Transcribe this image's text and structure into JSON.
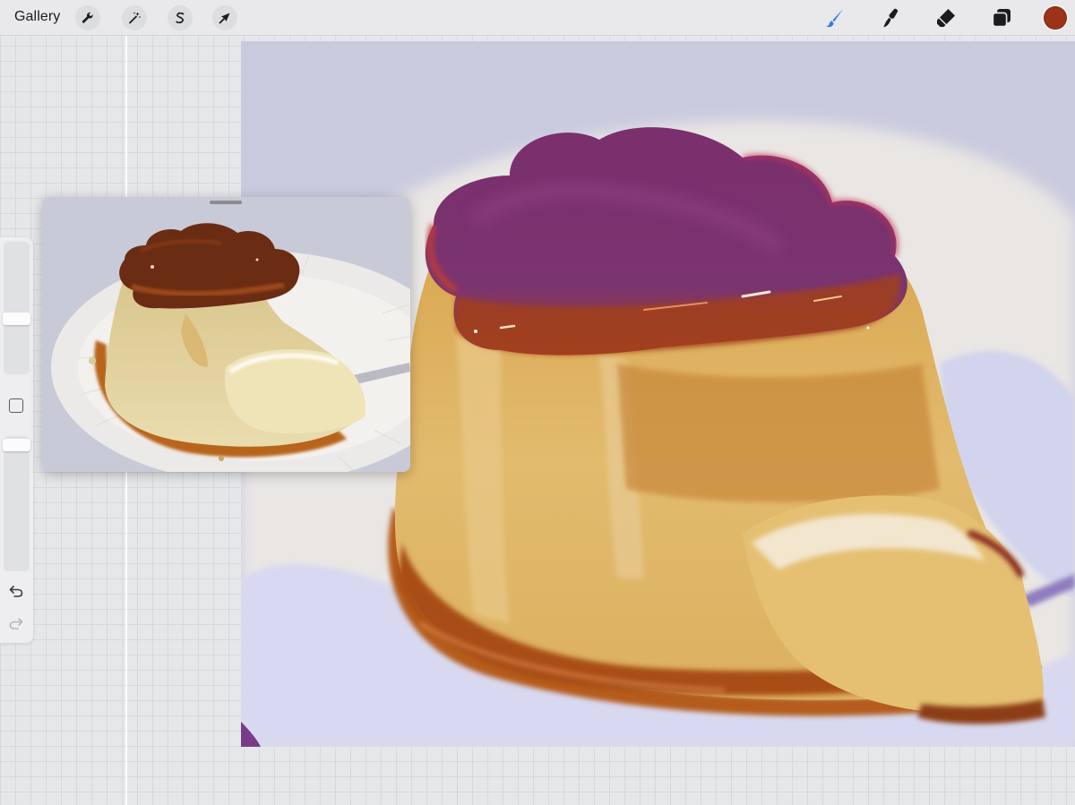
{
  "toolbar": {
    "gallery_label": "Gallery",
    "left_tools": [
      "wrench-icon",
      "magic-wand-icon",
      "selection-s-icon",
      "transform-arrow-icon"
    ],
    "right_tools": [
      "brush-icon",
      "smudge-icon",
      "eraser-icon",
      "layers-icon"
    ],
    "active_tool": "brush-icon",
    "active_tool_color": "#2f7de1",
    "current_color": "#9a3318"
  },
  "sidebar": {
    "size_slider_level": 0.22,
    "opacity_slider_level": 0.05,
    "controls": [
      "modify-button",
      "undo-icon",
      "redo-icon"
    ]
  },
  "reference": {
    "title": ""
  }
}
